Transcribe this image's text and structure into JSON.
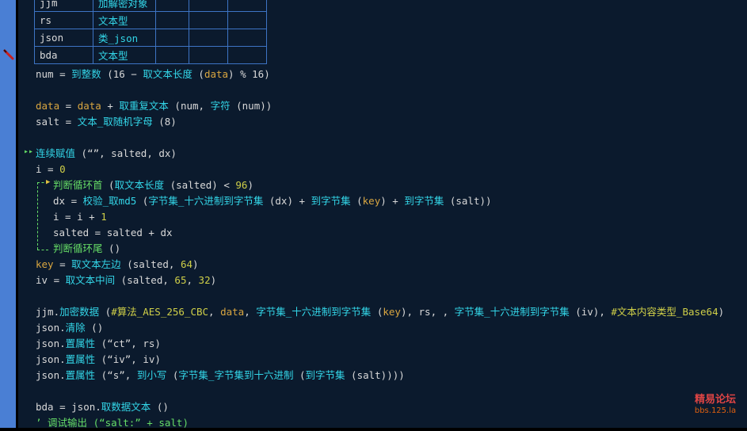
{
  "var_table": {
    "rows": [
      {
        "name": "jjm",
        "type": "加解密对象"
      },
      {
        "name": "rs",
        "type": "文本型"
      },
      {
        "name": "json",
        "type": "类_json"
      },
      {
        "name": "bda",
        "type": "文本型"
      }
    ]
  },
  "code": {
    "l_num": {
      "a": "num = ",
      "b": "到整数",
      "c": " (16 − ",
      "d": "取文本长度",
      "e": " (",
      "f": "data",
      "g": ") % 16)"
    },
    "l_data": {
      "a": "data",
      "b": " = ",
      "c": "data",
      "d": " + ",
      "e": "取重复文本",
      "f": " (num, ",
      "g": "字符",
      "h": " (num))"
    },
    "l_salt": {
      "a": "salt = ",
      "b": "文本_取随机字母",
      "c": " (8)"
    },
    "l_assign": {
      "a": "连续赋值",
      "b": " (“”, salted, dx)"
    },
    "l_i0": {
      "a": "i = ",
      "b": "0"
    },
    "l_loop": {
      "a": "判断循环首",
      "b": " (",
      "c": "取文本长度",
      "d": " (salted) < ",
      "e": "96",
      "f": ")"
    },
    "l_dx": {
      "a": "dx = ",
      "b": "校验_取md5",
      "c": " (",
      "d": "字节集_十六进制到字节集",
      "e": " (dx) + ",
      "f": "到字节集",
      "g": " (",
      "h": "key",
      "i": ") + ",
      "j": "到字节集",
      "k": " (salt))"
    },
    "l_inc": {
      "a": "i = i + ",
      "b": "1"
    },
    "l_salted": {
      "a": "salted = salted + dx"
    },
    "l_loopend": {
      "a": "判断循环尾",
      "b": " ()"
    },
    "l_key": {
      "a": "key",
      "b": " = ",
      "c": "取文本左边",
      "d": " (salted, ",
      "e": "64",
      "f": ")"
    },
    "l_iv": {
      "a": "iv = ",
      "b": "取文本中间",
      "c": " (salted, ",
      "d": "65",
      "e": ", ",
      "f": "32",
      "g": ")"
    },
    "l_enc": {
      "a": "jjm.",
      "b": "加密数据",
      "c": " (",
      "d": "#算法_AES_256_CBC",
      "e": ", ",
      "f": "data",
      "g": ", ",
      "h": "字节集_十六进制到字节集",
      "i": " (",
      "j": "key",
      "k": "), rs, , ",
      "l": "字节集_十六进制到字节集",
      "m": " (iv), ",
      "n": "#文本内容类型_Base64",
      "o": ")"
    },
    "l_clear": {
      "a": "json.",
      "b": "清除",
      "c": " ()"
    },
    "l_ct": {
      "a": "json.",
      "b": "置属性",
      "c": " (“ct”, rs)"
    },
    "l_ivp": {
      "a": "json.",
      "b": "置属性",
      "c": " (“iv”, iv)"
    },
    "l_s": {
      "a": "json.",
      "b": "置属性",
      "c": " (“s”, ",
      "d": "到小写",
      "e": " (",
      "f": "字节集_字节集到十六进制",
      "g": " (",
      "h": "到字节集",
      "i": " (salt))))"
    },
    "l_bda": {
      "a": "bda = json.",
      "b": "取数据文本",
      "c": " ()"
    },
    "l_debug": {
      "a": "’ 调试输出 (“salt:” + salt)"
    }
  },
  "watermark": {
    "line1": "精易论坛",
    "line2": "bbs.125.la"
  },
  "colors": {
    "editor_bg": "#0b1a2d",
    "gutter": "#4a7fd4",
    "identifier": "#d9d9d9",
    "function": "#33d6e8",
    "constant": "#cfcf48",
    "control": "#66dd66"
  }
}
